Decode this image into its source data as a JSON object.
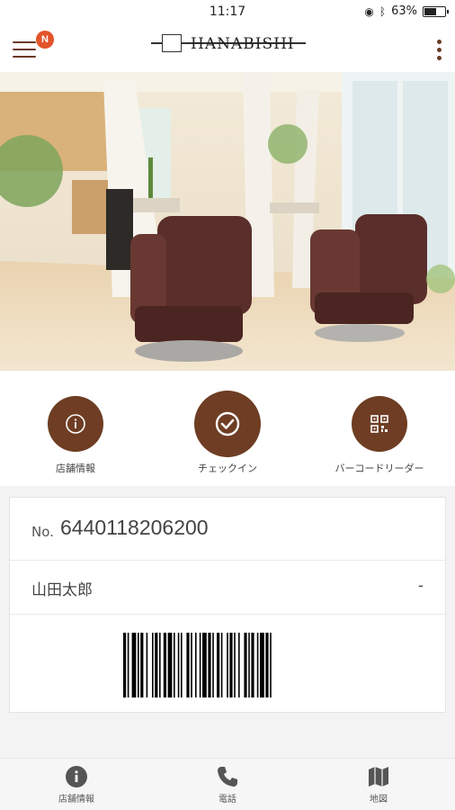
{
  "status": {
    "time": "11:17",
    "battery": "63%",
    "battery_level": 0.63
  },
  "header": {
    "notification_badge": "N",
    "logo_text": "HANABISHI"
  },
  "hero": {
    "image": "salon-interior-photo"
  },
  "actions": [
    {
      "label": "店舗情報",
      "icon": "info-icon"
    },
    {
      "label": "チェックイン",
      "icon": "check-icon"
    },
    {
      "label": "バーコードリーダー",
      "icon": "qr-code-icon"
    }
  ],
  "member": {
    "number_prefix": "No.",
    "number": "6440118206200",
    "name": "山田太郎",
    "name_suffix": "-"
  },
  "bottom_nav": [
    {
      "label": "店舗情報",
      "icon": "info-icon"
    },
    {
      "label": "電話",
      "icon": "phone-icon"
    },
    {
      "label": "地図",
      "icon": "map-icon"
    }
  ],
  "colors": {
    "brand": "#6e3d24",
    "badge": "#e2542a"
  }
}
